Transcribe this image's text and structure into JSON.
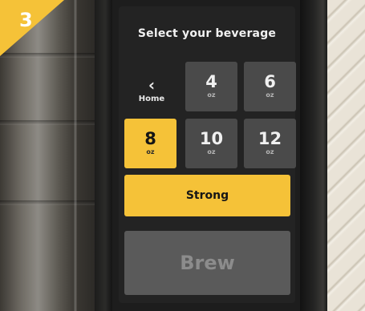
{
  "step_badge": {
    "number": "3",
    "color": "#f5c238"
  },
  "screen": {
    "title": "Select your beverage",
    "back_button": {
      "icon": "chevron-left-icon",
      "label": "Home"
    },
    "sizes": [
      {
        "value": "4",
        "unit": "oz",
        "selected": false
      },
      {
        "value": "6",
        "unit": "oz",
        "selected": false
      },
      {
        "value": "8",
        "unit": "oz",
        "selected": true
      },
      {
        "value": "10",
        "unit": "oz",
        "selected": false
      },
      {
        "value": "12",
        "unit": "oz",
        "selected": false
      }
    ],
    "strength_button": {
      "label": "Strong",
      "active": true
    },
    "brew_button": {
      "label": "Brew",
      "enabled": false
    }
  },
  "colors": {
    "accent": "#f5c238",
    "tile": "#4a4a4a",
    "screen_bg": "#232323",
    "brew_disabled": "#5a5a5a"
  }
}
